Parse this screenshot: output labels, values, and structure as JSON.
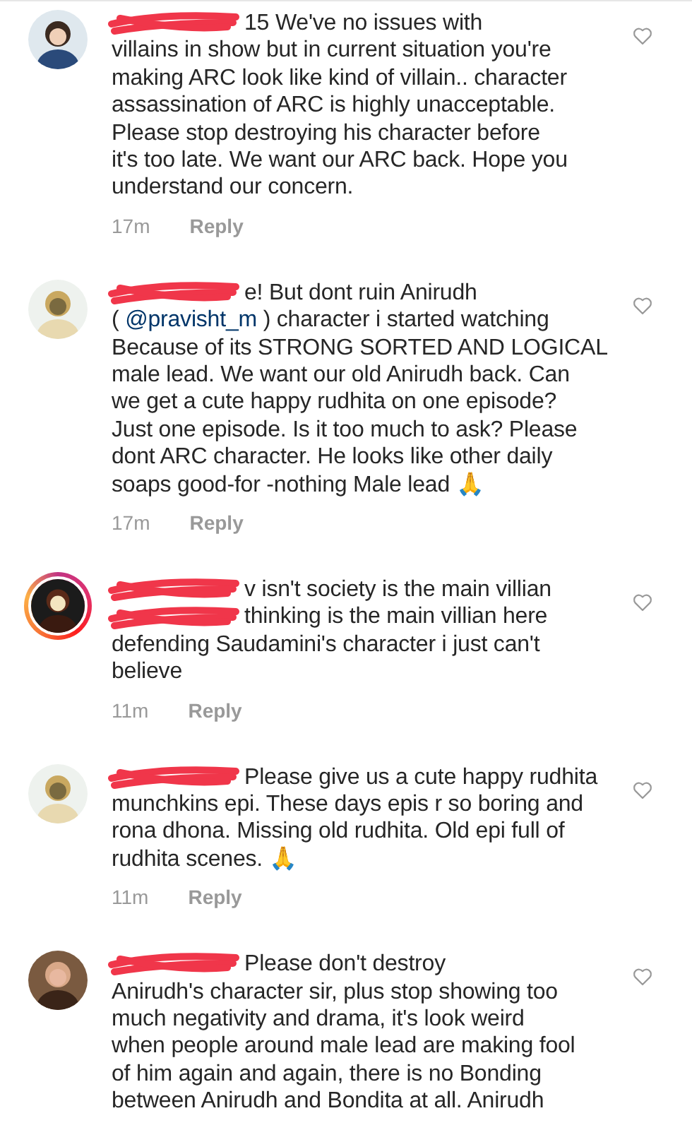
{
  "comments": [
    {
      "avatar": {
        "kind": "picture",
        "story_ring": false
      },
      "lines": [
        {
          "redacted": true,
          "text": "15 We've no issues with"
        },
        "villains in show but in current situation you're",
        "making ARC look like kind of villain.. character",
        "assassination of ARC is highly unacceptable.",
        "Please stop destroying his character before",
        "it's too late. We want our ARC back. Hope you",
        "understand our concern."
      ],
      "time": "17m",
      "reply": "Reply",
      "liked": false
    },
    {
      "avatar": {
        "kind": "picture",
        "story_ring": false
      },
      "lines": [
        {
          "redacted": true,
          "text": "e! But dont ruin Anirudh"
        },
        {
          "before": "(",
          "mention": "@pravisht_m",
          "after": ") character i started watching"
        },
        "Because of its STRONG SORTED AND LOGICAL",
        "male lead. We want our old Anirudh back. Can",
        "we get a cute happy rudhita on one episode?",
        "Just one episode. Is it too much to ask? Please",
        "dont ARC character. He looks like other daily",
        "soaps good-for -nothing Male lead 🙏"
      ],
      "time": "17m",
      "reply": "Reply",
      "liked": false
    },
    {
      "avatar": {
        "kind": "picture",
        "story_ring": true
      },
      "lines": [
        {
          "redacted": true,
          "text": "v isn't society is the main villian"
        },
        {
          "redacted": true,
          "text": "thinking is the main villian here"
        },
        "defending Saudamini's character i just can't",
        "believe"
      ],
      "time": "11m",
      "reply": "Reply",
      "liked": false
    },
    {
      "avatar": {
        "kind": "picture",
        "story_ring": false
      },
      "lines": [
        {
          "redacted": true,
          "text": "Please give us a cute happy rudhita"
        },
        "munchkins epi. These days epis r so boring and",
        "rona dhona. Missing old rudhita. Old epi full of",
        "rudhita scenes. 🙏"
      ],
      "time": "11m",
      "reply": "Reply",
      "liked": false
    },
    {
      "avatar": {
        "kind": "picture",
        "story_ring": false
      },
      "lines": [
        {
          "redacted": true,
          "text": "Please don't destroy"
        },
        "Anirudh's character sir, plus stop showing too",
        "much negativity and drama, it's look weird",
        "when people around male lead are making fool",
        "of him again and again, there is no Bonding",
        "between Anirudh and Bondita at all. Anirudh"
      ],
      "liked": false
    }
  ]
}
